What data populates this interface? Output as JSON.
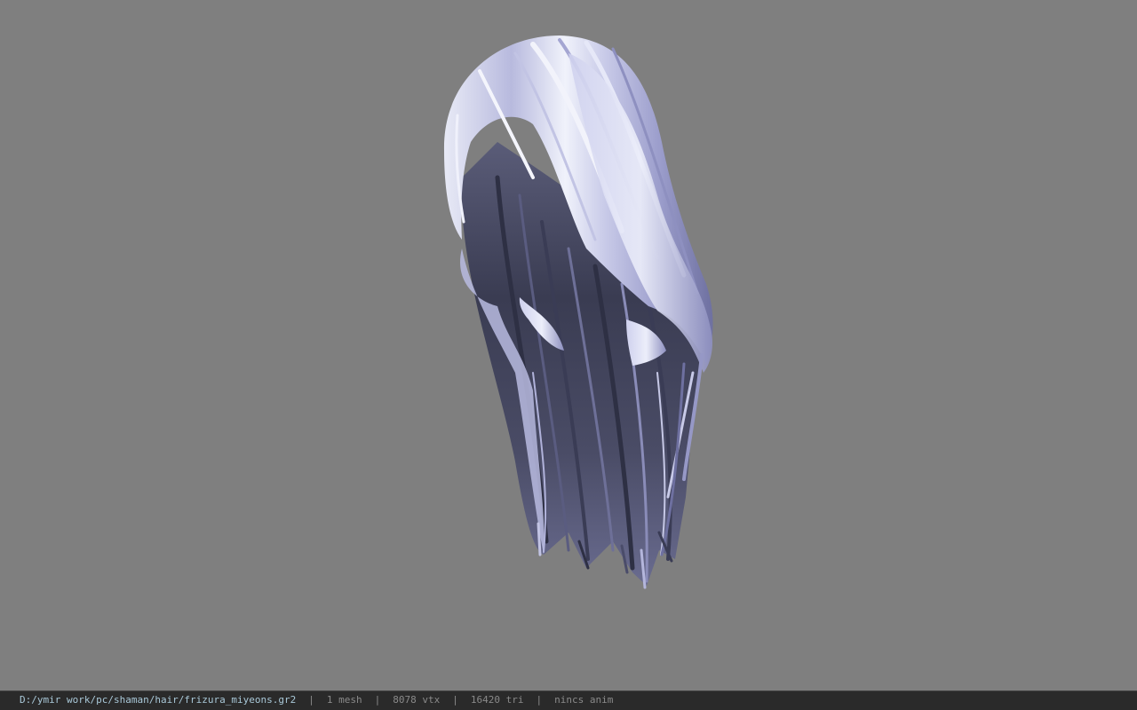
{
  "viewer": {
    "background_color": "#7f7f7f",
    "model_icon": "hair-mesh-model",
    "hair_colors": {
      "highlight": "#eef0fa",
      "light": "#c6c8e6",
      "mid": "#9a9cc8",
      "dark": "#4a4c6a",
      "deep": "#26283a"
    }
  },
  "status": {
    "file_path": "D:/ymir work/pc/shaman/hair/frizura_miyeons.gr2",
    "separator": "|",
    "mesh_count": "1 mesh",
    "vertex_count": "8078 vtx",
    "triangle_count": "16420 tri",
    "anim_status": "nincs anim"
  }
}
